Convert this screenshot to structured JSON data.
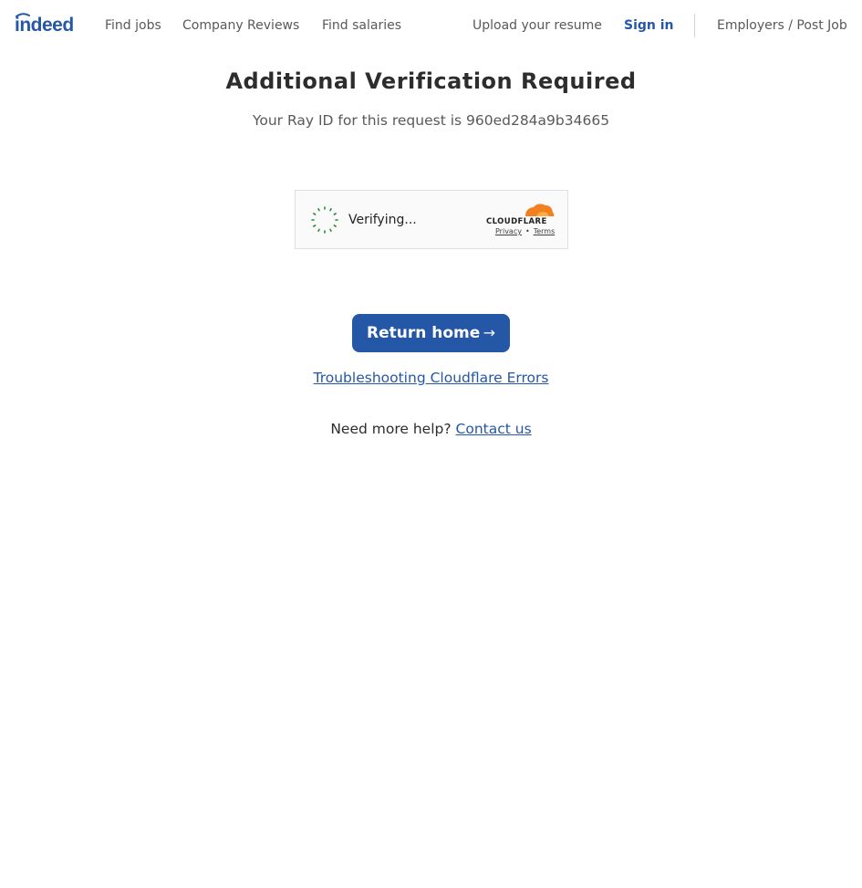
{
  "header": {
    "logo_text": "indeed",
    "nav": {
      "find_jobs": "Find jobs",
      "company_reviews": "Company Reviews",
      "find_salaries": "Find salaries",
      "upload_resume": "Upload your resume",
      "sign_in": "Sign in",
      "employers": "Employers / Post Job"
    }
  },
  "main": {
    "title": "Additional Verification Required",
    "ray_id_text": "Your Ray ID for this request is 960ed284a9b34665",
    "captcha": {
      "status": "Verifying...",
      "brand": "CLOUDFLARE",
      "privacy_link": "Privacy",
      "separator": "•",
      "terms_link": "Terms"
    },
    "return_button": "Return home",
    "return_arrow": "→",
    "troubleshoot_link": "Troubleshooting Cloudflare Errors",
    "help_prefix": "Need more help?",
    "contact_link": "Contact us"
  },
  "colors": {
    "brand_blue": "#2557a7",
    "text_dark": "#2d2d2d",
    "text_muted": "#595959",
    "spinner_green": "#1e8b3a",
    "cloudflare_orange": "#f38020"
  },
  "icons": {
    "logo": "indeed-logo-icon",
    "spinner": "loading-spinner-icon",
    "cloudflare": "cloudflare-cloud-icon"
  }
}
